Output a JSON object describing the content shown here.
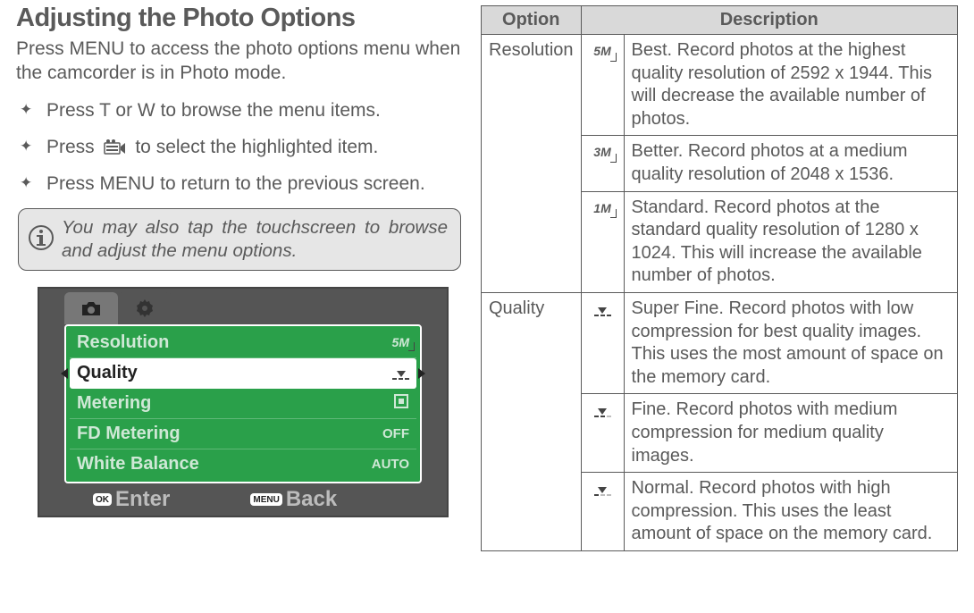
{
  "title": "Adjusting the Photo Options",
  "intro": "Press MENU to access the photo options menu when the camcorder is in Photo mode.",
  "steps": [
    "Press T or W to browse the menu items.",
    "Press __CAM__ to select the highlighted item.",
    "Press MENU to return to the previous screen."
  ],
  "info_note": "You may also tap the touchscreen to browse and adjust the menu options.",
  "screenshot": {
    "items": [
      {
        "label": "Resolution",
        "value": "5M"
      },
      {
        "label": "Quality",
        "value": ""
      },
      {
        "label": "Metering",
        "value": ""
      },
      {
        "label": "FD Metering",
        "value": "OFF"
      },
      {
        "label": "White Balance",
        "value": "AUTO"
      }
    ],
    "selected_index": 1,
    "footer_ok_key": "OK",
    "footer_ok": "Enter",
    "footer_back_key": "MENU",
    "footer_back": "Back"
  },
  "table": {
    "headers": [
      "Option",
      "Description"
    ],
    "rows": [
      {
        "option": "Resolution",
        "entries": [
          {
            "icon_type": "res",
            "icon_label": "5M",
            "desc": "Best. Record photos at the highest quality resolution of 2592 x 1944. This will decrease the available number of photos."
          },
          {
            "icon_type": "res",
            "icon_label": "3M",
            "desc": "Better. Record photos at a medium quality resolution of 2048 x 1536."
          },
          {
            "icon_type": "res",
            "icon_label": "1M",
            "desc": "Standard. Record photos at the standard quality resolution of 1280 x 1024. This will increase the avail­able number of photos."
          }
        ]
      },
      {
        "option": "Quality",
        "entries": [
          {
            "icon_type": "qual",
            "level": 3,
            "desc": "Super Fine. Record photos with low compression for best quality im­ages. This uses the most amount of space on the memory card."
          },
          {
            "icon_type": "qual",
            "level": 2,
            "desc": "Fine. Record photos with medium compression for medium quality images."
          },
          {
            "icon_type": "qual",
            "level": 1,
            "desc": "Normal. Record photos with high compression. This uses the least amount of space on the memory card."
          }
        ]
      }
    ]
  }
}
